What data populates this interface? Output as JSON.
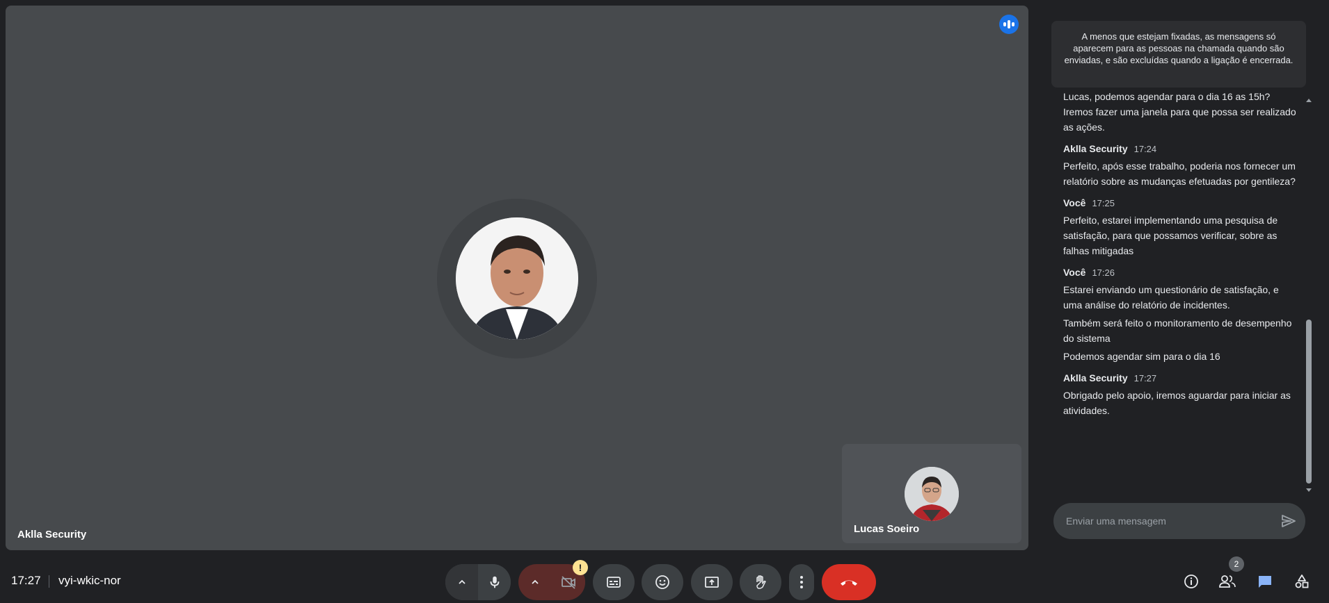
{
  "stage": {
    "main_participant": "Aklla Security",
    "self_participant": "Lucas Soeiro"
  },
  "chat": {
    "notice": "A menos que estejam fixadas, as mensagens só aparecem para as pessoas na chamada quando são enviadas, e são excluídas quando a ligação é encerrada.",
    "groups": [
      {
        "sender": "",
        "time": "",
        "messages": [
          "Lucas, podemos agendar para o dia 16 as 15h? Iremos fazer uma janela para que possa ser realizado as ações."
        ]
      },
      {
        "sender": "Aklla Security",
        "time": "17:24",
        "messages": [
          "Perfeito, após esse trabalho, poderia nos fornecer um relatório sobre as mudanças efetuadas por gentileza?"
        ]
      },
      {
        "sender": "Você",
        "time": "17:25",
        "messages": [
          "Perfeito, estarei implementando uma pesquisa de satisfação, para que possamos verificar, sobre as falhas mitigadas"
        ]
      },
      {
        "sender": "Você",
        "time": "17:26",
        "messages": [
          "Estarei enviando um questionário de satisfação, e uma análise do relatório de incidentes.",
          "Também será feito o monitoramento de desempenho do sistema",
          "Podemos agendar sim para o dia 16"
        ]
      },
      {
        "sender": "Aklla Security",
        "time": "17:27",
        "messages": [
          "Obrigado pelo apoio, iremos aguardar para iniciar as atividades."
        ]
      }
    ],
    "input_placeholder": "Enviar uma mensagem"
  },
  "bottom_bar": {
    "clock": "17:27",
    "meeting_code": "vyi-wkic-nor",
    "camera_warning": "!",
    "people_count": "2"
  },
  "colors": {
    "leave": "#d93025",
    "accent": "#8ab4f8",
    "speaking": "#1a73e8",
    "warning": "#fde293"
  }
}
